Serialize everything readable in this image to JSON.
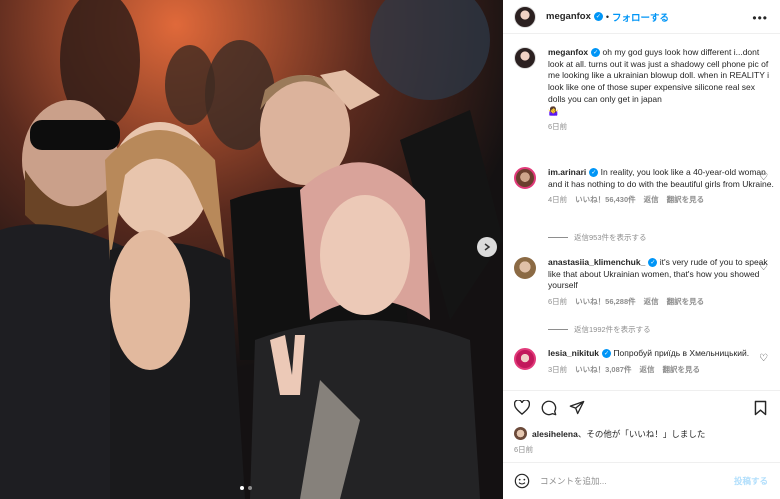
{
  "header": {
    "username": "meganfox",
    "follow_label": "フォローする"
  },
  "caption": {
    "username": "meganfox",
    "text": "oh my god guys look how different i...dont look at all. turns out it was just a shadowy cell phone pic of me looking like a ukrainian blowup doll. when in REALITY i look like one of those super expensive silicone real sex dolls you can only get in japan",
    "emoji": "🤷‍♀️",
    "time": "6日前"
  },
  "comments": [
    {
      "username": "im.arinari",
      "text": "In reality, you look like a 40-year-old woman and it has nothing to do with the beautiful girls from Ukraine.",
      "time": "4日前",
      "likes": "いいね！56,430件",
      "reply": "返信",
      "translate": "翻訳を見る",
      "replies": "返信953件を表示する"
    },
    {
      "username": "anastasiia_klimenchuk_",
      "text": "it's very rude of you to speak like that about Ukrainian women, that's how you showed yourself",
      "time": "6日前",
      "likes": "いいね！56,288件",
      "reply": "返信",
      "translate": "翻訳を見る",
      "replies": "返信1992件を表示する"
    },
    {
      "username": "lesia_nikituk",
      "text": "Попробуй приїдь в Хмельницький.",
      "time": "3日前",
      "likes": "いいね！3,087件",
      "reply": "返信",
      "translate": "翻訳を見る"
    }
  ],
  "likes_line": {
    "user": "alesihelena",
    "suffix": "、その他が「いいね！」しました"
  },
  "post_time": "6日前",
  "composer": {
    "placeholder": "コメントを追加...",
    "post_label": "投稿する"
  },
  "icons": {
    "like": "heart-icon",
    "comment": "comment-icon",
    "share": "share-icon",
    "save": "bookmark-icon",
    "emoji": "emoji-icon",
    "more": "more-icon"
  }
}
